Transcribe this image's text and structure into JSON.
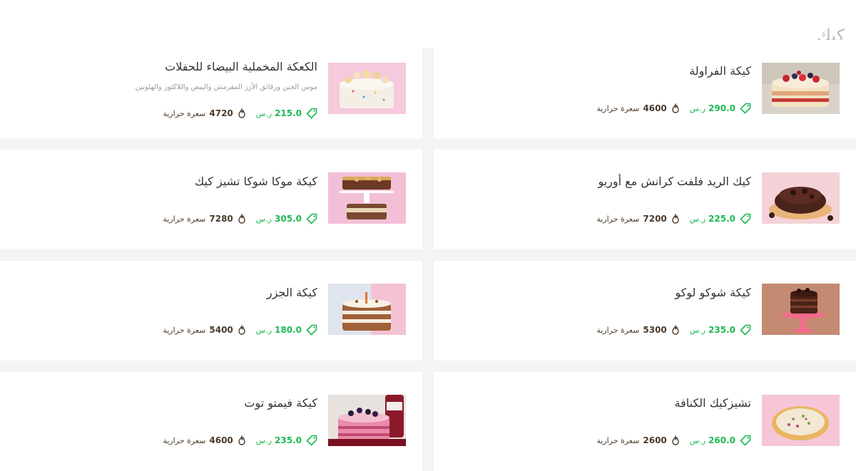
{
  "section": {
    "title": "كيك"
  },
  "colors": {
    "price": "#1db954",
    "calories": "#4a3a2a",
    "title": "#333333"
  },
  "products": [
    {
      "id": "p1",
      "name": "كيكة الفراولة",
      "description": "",
      "price": "290.0",
      "currency": "ر.س",
      "calories": "4600",
      "calories_label": "سعرة حرارية",
      "image": "strawberry-cake"
    },
    {
      "id": "p2",
      "name": "الكعكة المخملية البيضاء للحفلات",
      "description": "موس الجبن ورقائق الأرز المقرمش والبيض واللاكتوز والهلوتين",
      "price": "215.0",
      "currency": "ر.س",
      "calories": "4720",
      "calories_label": "سعرة حرارية",
      "image": "white-velvet-cake"
    },
    {
      "id": "p3",
      "name": "كيك الريد فلفت كرانش مع أوريو",
      "description": "",
      "price": "225.0",
      "currency": "ر.س",
      "calories": "7200",
      "calories_label": "سعرة حرارية",
      "image": "red-velvet-oreo-cake"
    },
    {
      "id": "p4",
      "name": "كيكة موكا شوكا تشيز كيك",
      "description": "",
      "price": "305.0",
      "currency": "ر.س",
      "calories": "7280",
      "calories_label": "سعرة حرارية",
      "image": "mocha-cheesecake"
    },
    {
      "id": "p5",
      "name": "كيكة شوكو لوكو",
      "description": "",
      "price": "235.0",
      "currency": "ر.س",
      "calories": "5300",
      "calories_label": "سعرة حرارية",
      "image": "choco-loco-cake"
    },
    {
      "id": "p6",
      "name": "كيكة الجزر",
      "description": "",
      "price": "180.0",
      "currency": "ر.س",
      "calories": "5400",
      "calories_label": "سعرة حرارية",
      "image": "carrot-cake"
    },
    {
      "id": "p7",
      "name": "تشيزكيك الكنافة",
      "description": "",
      "price": "260.0",
      "currency": "ر.س",
      "calories": "2600",
      "calories_label": "سعرة حرارية",
      "image": "kunafa-cheesecake"
    },
    {
      "id": "p8",
      "name": "كيكة فيمتو توت",
      "description": "",
      "price": "235.0",
      "currency": "ر.س",
      "calories": "4600",
      "calories_label": "سعرة حرارية",
      "image": "vimto-berry-cake"
    }
  ]
}
